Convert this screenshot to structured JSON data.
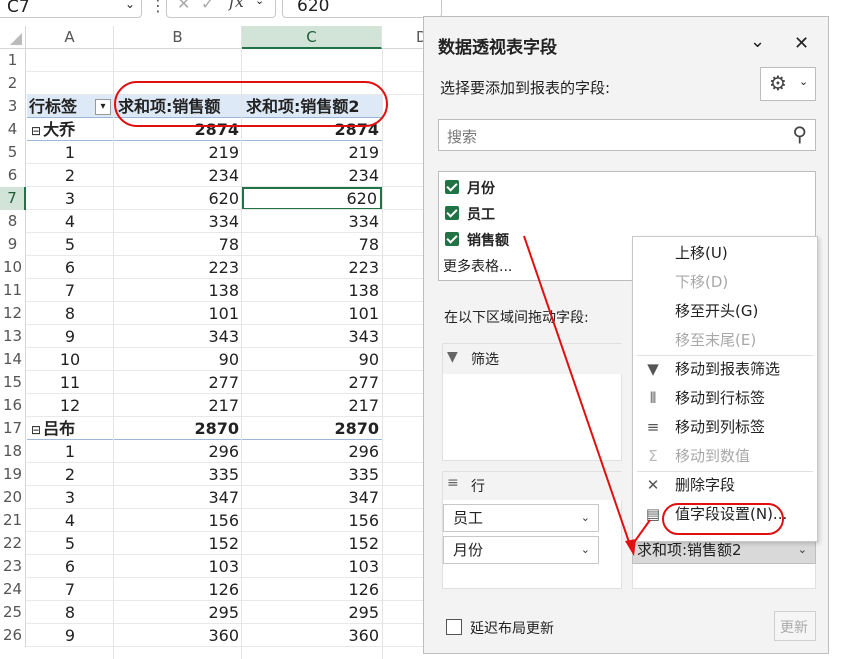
{
  "formula_bar": {
    "name_box": "C7",
    "fx": "fx",
    "value": "620"
  },
  "columns": [
    "A",
    "B",
    "C",
    "D"
  ],
  "rows": [
    {
      "n": "1",
      "a": "",
      "b": "",
      "c": ""
    },
    {
      "n": "2",
      "a": "",
      "b": "",
      "c": ""
    },
    {
      "n": "3",
      "a": "行标签",
      "b": "求和项:销售额",
      "c": "求和项:销售额2"
    },
    {
      "n": "4",
      "a": "大乔",
      "b": "2874",
      "c": "2874"
    },
    {
      "n": "5",
      "a": "1",
      "b": "219",
      "c": "219"
    },
    {
      "n": "6",
      "a": "2",
      "b": "234",
      "c": "234"
    },
    {
      "n": "7",
      "a": "3",
      "b": "620",
      "c": "620"
    },
    {
      "n": "8",
      "a": "4",
      "b": "334",
      "c": "334"
    },
    {
      "n": "9",
      "a": "5",
      "b": "78",
      "c": "78"
    },
    {
      "n": "10",
      "a": "6",
      "b": "223",
      "c": "223"
    },
    {
      "n": "11",
      "a": "7",
      "b": "138",
      "c": "138"
    },
    {
      "n": "12",
      "a": "8",
      "b": "101",
      "c": "101"
    },
    {
      "n": "13",
      "a": "9",
      "b": "343",
      "c": "343"
    },
    {
      "n": "14",
      "a": "10",
      "b": "90",
      "c": "90"
    },
    {
      "n": "15",
      "a": "11",
      "b": "277",
      "c": "277"
    },
    {
      "n": "16",
      "a": "12",
      "b": "217",
      "c": "217"
    },
    {
      "n": "17",
      "a": "吕布",
      "b": "2870",
      "c": "2870"
    },
    {
      "n": "18",
      "a": "1",
      "b": "296",
      "c": "296"
    },
    {
      "n": "19",
      "a": "2",
      "b": "335",
      "c": "335"
    },
    {
      "n": "20",
      "a": "3",
      "b": "347",
      "c": "347"
    },
    {
      "n": "21",
      "a": "4",
      "b": "156",
      "c": "156"
    },
    {
      "n": "22",
      "a": "5",
      "b": "152",
      "c": "152"
    },
    {
      "n": "23",
      "a": "6",
      "b": "103",
      "c": "103"
    },
    {
      "n": "24",
      "a": "7",
      "b": "126",
      "c": "126"
    },
    {
      "n": "25",
      "a": "8",
      "b": "295",
      "c": "295"
    },
    {
      "n": "26",
      "a": "9",
      "b": "360",
      "c": "360"
    }
  ],
  "pane": {
    "title": "数据透视表字段",
    "choose_label": "选择要添加到报表的字段:",
    "search_placeholder": "搜索",
    "fields": [
      "月份",
      "员工",
      "销售额"
    ],
    "more_tables": "更多表格...",
    "drag_label": "在以下区域间拖动字段:",
    "filter_label": "筛选",
    "rows_label": "行",
    "row_items": [
      "员工",
      "月份"
    ],
    "values_item": "求和项:销售额2",
    "defer_label": "延迟布局更新",
    "update_button": "更新"
  },
  "context_menu": {
    "items": [
      {
        "label": "上移(U)",
        "disabled": false,
        "icon": ""
      },
      {
        "label": "下移(D)",
        "disabled": true,
        "icon": ""
      },
      {
        "label": "移至开头(G)",
        "disabled": false,
        "icon": ""
      },
      {
        "label": "移至末尾(E)",
        "disabled": true,
        "icon": ""
      },
      {
        "label": "移动到报表筛选",
        "disabled": false,
        "icon": "filter-icon"
      },
      {
        "label": "移动到行标签",
        "disabled": false,
        "icon": "rows-icon"
      },
      {
        "label": "移动到列标签",
        "disabled": false,
        "icon": "columns-icon"
      },
      {
        "label": "移动到数值",
        "disabled": true,
        "icon": "sigma-icon"
      },
      {
        "label": "删除字段",
        "disabled": false,
        "icon": "x-icon"
      },
      {
        "label": "值字段设置(N)...",
        "disabled": false,
        "icon": "field-settings-icon"
      }
    ]
  },
  "colors": {
    "accent": "#217346",
    "annotation": "#e01010"
  }
}
